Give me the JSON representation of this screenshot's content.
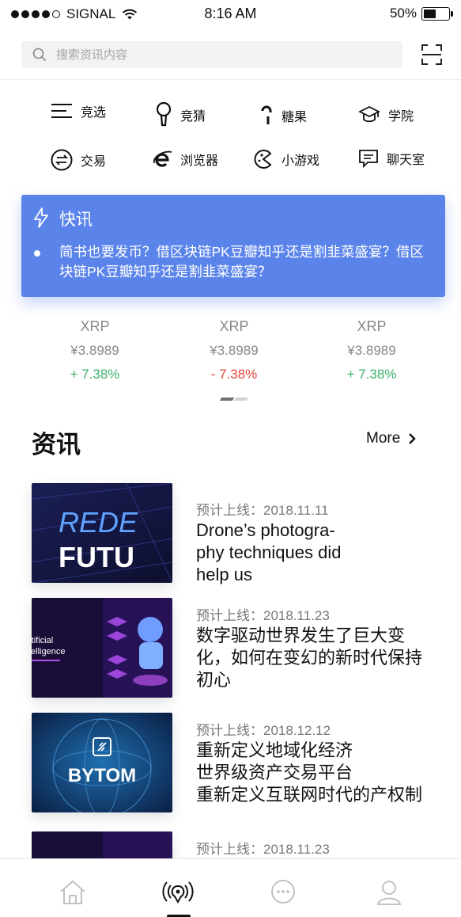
{
  "status_bar": {
    "carrier": "SIGNAL",
    "time": "8:16 AM",
    "battery": "50%",
    "battery_level": 0.5
  },
  "search": {
    "placeholder": "搜索资讯内容"
  },
  "categories": [
    {
      "label": "竞选",
      "icon": "menu-lines-icon"
    },
    {
      "label": "竞猜",
      "icon": "bulb-pin-icon"
    },
    {
      "label": "糖果",
      "icon": "candy-cane-icon"
    },
    {
      "label": "学院",
      "icon": "graduation-cap-icon"
    },
    {
      "label": "交易",
      "icon": "exchange-icon"
    },
    {
      "label": "浏览器",
      "icon": "browser-e-icon"
    },
    {
      "label": "小游戏",
      "icon": "pacman-game-icon"
    },
    {
      "label": "聊天室",
      "icon": "chat-bubble-icon"
    }
  ],
  "flash": {
    "title": "快讯",
    "text": "简书也要发币？借区块链PK豆瓣知乎还是割韭菜盛宴？借区块链PK豆瓣知乎还是割韭菜盛宴？"
  },
  "tickers": [
    {
      "symbol": "XRP",
      "price": "¥3.8989",
      "change": "+ 7.38%",
      "direction": "up"
    },
    {
      "symbol": "XRP",
      "price": "¥3.8989",
      "change": "- 7.38%",
      "direction": "down"
    },
    {
      "symbol": "XRP",
      "price": "¥3.8989",
      "change": "+ 7.38%",
      "direction": "up"
    }
  ],
  "news": {
    "title": "资讯",
    "more": "More",
    "items": [
      {
        "date": "预计上线：2018.11.11",
        "headline": "Drone’s photogra-\nphy  techniques did\nhelp us",
        "thumb_text_1": "REDE",
        "thumb_text_2": "FUTU"
      },
      {
        "date": "预计上线：2018.11.23",
        "headline": "数字驱动世界发生了巨大变化，如何在变幻的新时代保持初心",
        "thumb_text_1": "rtificial",
        "thumb_text_2": "telligence"
      },
      {
        "date": "预计上线：2018.12.12",
        "headline": "重新定义地域化经济\n世界级资产交易平台\n重新定义互联网时代的产权制",
        "thumb_text_1": "BYTOM"
      },
      {
        "date": "预计上线：2018.11.23",
        "headline": ""
      }
    ]
  },
  "colors": {
    "accent": "#5b84ea",
    "up": "#3aaf6a",
    "down": "#e2443d"
  }
}
